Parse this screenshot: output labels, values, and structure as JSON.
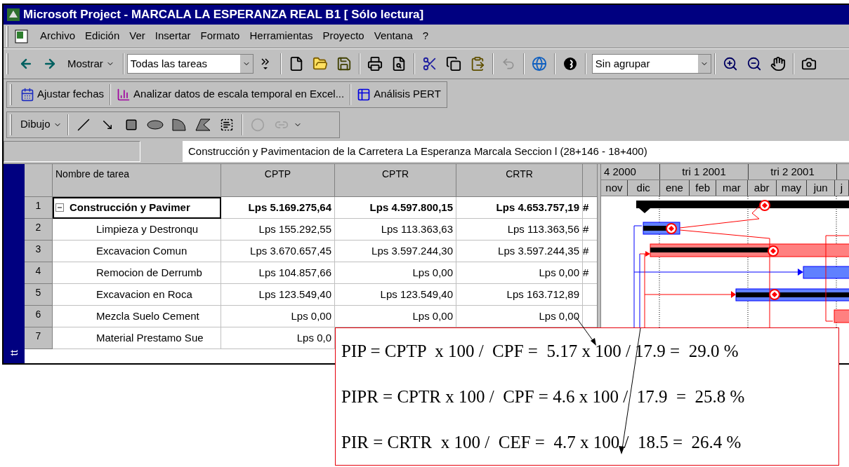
{
  "window": {
    "title": "Microsoft Project - MARCALA LA ESPERANZA REAL B1 [ Sólo lectura]"
  },
  "menu": [
    "Archivo",
    "Edición",
    "Ver",
    "Insertar",
    "Formato",
    "Herramientas",
    "Proyecto",
    "Ventana",
    "?"
  ],
  "toolbar": {
    "show_menu": "Mostrar",
    "filter": {
      "value": "Todas las tareas"
    },
    "group": {
      "value": "Sin agrupar"
    }
  },
  "analysis_toolbar": [
    "Ajustar fechas",
    "Analizar datos de escala temporal en Excel...",
    "Análisis PERT"
  ],
  "drawing_toolbar": {
    "menu": "Dibujo"
  },
  "entry_bar": {
    "value": "Construcción y Pavimentacion de la Carretera La Esperanza Marcala Seccion l (28+146 - 18+400)"
  },
  "view_bar": {
    "label": "tt"
  },
  "table": {
    "columns": [
      "Nombre de tarea",
      "CPTP",
      "CPTR",
      "CRTR"
    ],
    "rows": [
      {
        "row_number": "1",
        "kind": "summary",
        "selected": true,
        "name": "Construcción y Pavimer",
        "cptp": "Lps 5.169.275,64",
        "cptr": "Lps 4.597.800,15",
        "crtr": "Lps 4.653.757,19",
        "column_5": "#"
      },
      {
        "row_number": "2",
        "kind": "task",
        "selected": false,
        "name": "Limpieza y Destronqu",
        "cptp": "Lps 155.292,55",
        "cptr": "Lps 113.363,63",
        "crtr": "Lps 113.363,56",
        "column_5": "#"
      },
      {
        "row_number": "3",
        "kind": "task",
        "selected": false,
        "name": "Excavacion Comun",
        "cptp": "Lps 3.670.657,45",
        "cptr": "Lps 3.597.244,30",
        "crtr": "Lps 3.597.244,35",
        "column_5": "#"
      },
      {
        "row_number": "4",
        "kind": "task",
        "selected": false,
        "name": "Remocion de Derrumb",
        "cptp": "Lps 104.857,66",
        "cptr": "Lps 0,00",
        "crtr": "Lps 0,00",
        "column_5": "#"
      },
      {
        "row_number": "5",
        "kind": "task",
        "selected": false,
        "name": "Excavacion en Roca",
        "cptp": "Lps 123.549,40",
        "cptr": "Lps 123.549,40",
        "crtr": "Lps 163.712,89"
      },
      {
        "row_number": "6",
        "kind": "task",
        "selected": false,
        "name": "Mezcla Suelo Cement",
        "cptp": "Lps 0,00",
        "cptr": "Lps 0,00",
        "crtr": "Lps 0,00"
      },
      {
        "row_number": "7",
        "kind": "task",
        "selected": false,
        "name": "Material Prestamo Sue",
        "cptp": "Lps 0,0"
      }
    ]
  },
  "timescale": {
    "major": [
      "4 2000",
      "tri 1 2001",
      "tri 2 2001"
    ],
    "minor": [
      "nov",
      "dic",
      "ene",
      "feb",
      "mar",
      "abr",
      "may",
      "jun",
      "j"
    ]
  },
  "annotation": {
    "lines": [
      "PIP = CPTP  x 100 /  CPF =  5.17 x 100 / 17.9 =  29.0 %",
      "PIPR = CPTR x 100 /  CPF = 4.6 x 100 /  17.9  =  25.8 %",
      "PIR = CRTR  x 100 /  CEF =  4.7 x 100 /  18.5 =  26.4 %"
    ]
  }
}
